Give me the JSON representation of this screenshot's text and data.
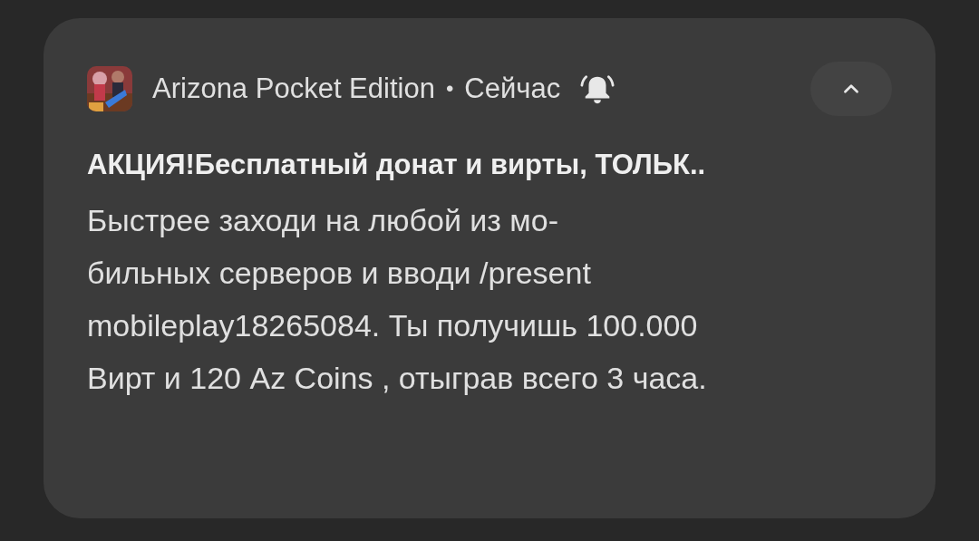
{
  "notification": {
    "app_name": "Arizona Pocket Edition",
    "separator": "•",
    "time": "Сейчас",
    "alerting": true,
    "expanded": true,
    "title": "АКЦИЯ!Бесплатный донат и вирты, ТОЛЬК..",
    "body": "Быстрее заходи на любой из мо-\nбильных серверов и вводи /present\nmobileplay18265084. Ты получишь 100.000\nВирт и 120 Az Coins , отыграв всего 3 часа."
  }
}
